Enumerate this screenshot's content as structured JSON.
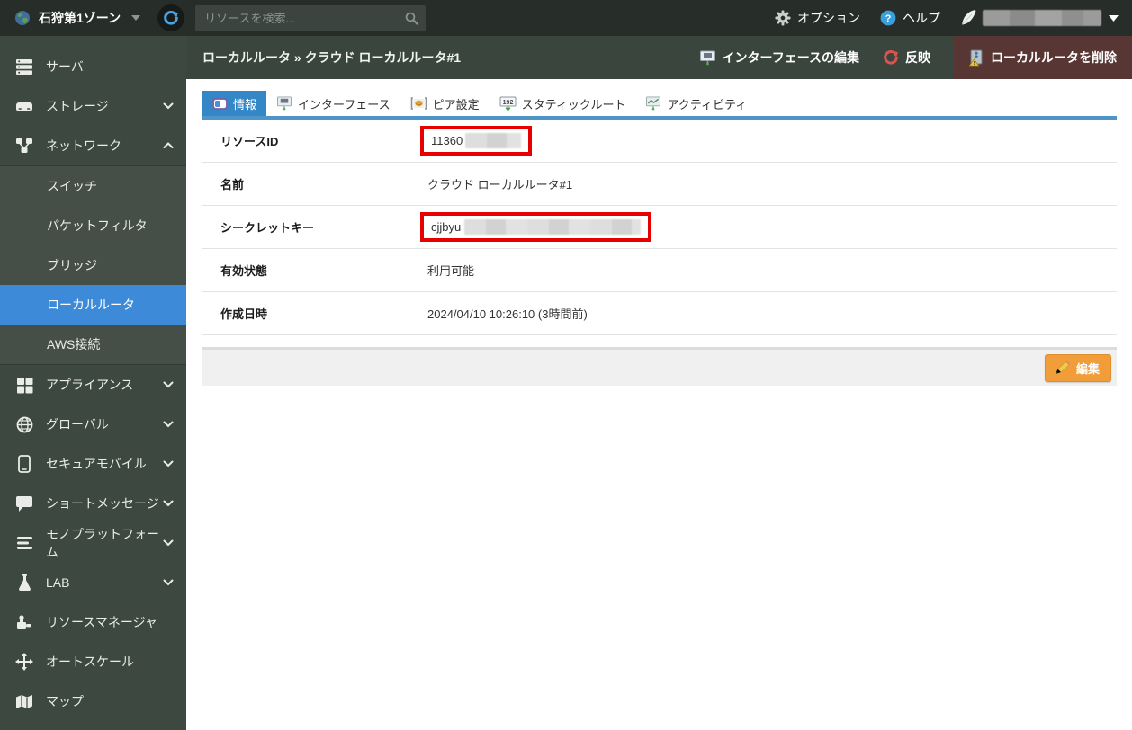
{
  "topbar": {
    "zone": {
      "label": "石狩第1ゾーン"
    },
    "search": {
      "placeholder": "リソースを検索..."
    },
    "options_label": "オプション",
    "help_label": "ヘルプ"
  },
  "sidebar": {
    "items": [
      {
        "id": "server",
        "icon": "server",
        "label": "サーバ"
      },
      {
        "id": "storage",
        "icon": "storage",
        "label": "ストレージ",
        "chevron": "down"
      },
      {
        "id": "network",
        "icon": "network",
        "label": "ネットワーク",
        "chevron": "up",
        "expanded": true
      },
      {
        "id": "switch",
        "sub": true,
        "label": "スイッチ"
      },
      {
        "id": "packet-filter",
        "sub": true,
        "label": "パケットフィルタ"
      },
      {
        "id": "bridge",
        "sub": true,
        "label": "ブリッジ"
      },
      {
        "id": "local-router",
        "sub": true,
        "label": "ローカルルータ",
        "selected": true
      },
      {
        "id": "aws-connect",
        "sub": true,
        "label": "AWS接続"
      },
      {
        "id": "appliance",
        "icon": "appliance",
        "label": "アプライアンス",
        "chevron": "down"
      },
      {
        "id": "global",
        "icon": "globe",
        "label": "グローバル",
        "chevron": "down"
      },
      {
        "id": "secure-mobile",
        "icon": "mobile",
        "label": "セキュアモバイル",
        "chevron": "down"
      },
      {
        "id": "short-message",
        "icon": "message",
        "label": "ショートメッセージ",
        "chevron": "down"
      },
      {
        "id": "mono-platform",
        "icon": "mono",
        "label": "モノプラットフォーム",
        "chevron": "down"
      },
      {
        "id": "lab",
        "icon": "lab",
        "label": "LAB",
        "chevron": "down"
      },
      {
        "id": "resource-manager",
        "icon": "rmanager",
        "label": "リソースマネージャ"
      },
      {
        "id": "auto-scale",
        "icon": "autoscale",
        "label": "オートスケール"
      },
      {
        "id": "map",
        "icon": "map",
        "label": "マップ"
      }
    ]
  },
  "header": {
    "breadcrumb": "ローカルルータ » クラウド ローカルルータ#1",
    "actions": {
      "edit_interface": "インターフェースの編集",
      "reflect": "反映",
      "delete": "ローカルルータを削除"
    }
  },
  "tabs": [
    {
      "id": "info",
      "icon": "tab-info",
      "label": "情報",
      "selected": true
    },
    {
      "id": "interface",
      "icon": "tab-interface",
      "label": "インターフェース"
    },
    {
      "id": "peer",
      "icon": "tab-peer",
      "label": "ピア設定"
    },
    {
      "id": "static-route",
      "icon": "tab-route",
      "label": "スタティックルート",
      "icon_badge": "192"
    },
    {
      "id": "activity",
      "icon": "tab-activity",
      "label": "アクティビティ"
    }
  ],
  "info": {
    "rows": [
      {
        "id": "resource_id",
        "label": "リソースID",
        "value": "11360",
        "masked": true,
        "highlighted": true
      },
      {
        "id": "name",
        "label": "名前",
        "value": "クラウド ローカルルータ#1"
      },
      {
        "id": "secret_key",
        "label": "シークレットキー",
        "value": "cjjbyu",
        "masked": true,
        "highlighted": true
      },
      {
        "id": "status",
        "label": "有効状態",
        "value": "利用可能"
      },
      {
        "id": "created_at",
        "label": "作成日時",
        "value": "2024/04/10 10:26:10 (3時間前)"
      }
    ],
    "edit_button": "編集"
  },
  "colors": {
    "accent_blue": "#3d8bd8",
    "tab_blue": "#3487c7",
    "delete_maroon": "#573634",
    "edit_orange": "#f09d3a",
    "highlight_red": "#e60000",
    "sidebar_bg": "#3d4841",
    "topbar_bg": "#272e2a"
  }
}
